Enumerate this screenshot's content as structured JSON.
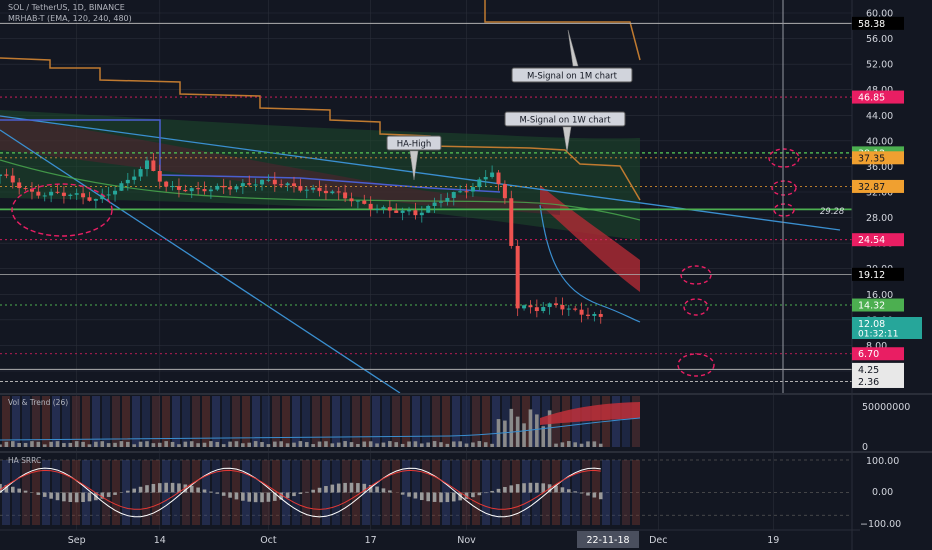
{
  "header": {
    "symbol": "SOL / TetherUS, 1D, BINANCE",
    "indicator": "MRHAB-T (EMA, 120, 240, 480)"
  },
  "colors": {
    "bg": "#131722",
    "grid": "#2a2e39",
    "up": "#26a69a",
    "down": "#ef5350",
    "green": "#4caf50",
    "orange": "#d08a30",
    "blue": "#3a8fd0",
    "pink": "#e91e63",
    "tag_green": "#4caf50",
    "tag_orange": "#f0a030",
    "tag_pink": "#e91e63",
    "tag_black": "#000000",
    "tag_white": "#e8e8e8"
  },
  "price_axis": {
    "ticks": [
      "60.00",
      "56.00",
      "52.00",
      "48.00",
      "44.00",
      "40.00",
      "36.00",
      "32.00",
      "28.00",
      "24.00",
      "20.00",
      "16.00",
      "12.00",
      "8.00",
      "4.00"
    ],
    "tags": [
      {
        "label": "58.38",
        "value": 58.38,
        "style": "black"
      },
      {
        "label": "46.85",
        "value": 46.85,
        "style": "pink"
      },
      {
        "label": "38.12",
        "value": 38.12,
        "style": "green"
      },
      {
        "label": "37.35",
        "value": 37.35,
        "style": "orange"
      },
      {
        "label": "32.87",
        "value": 32.87,
        "style": "orange"
      },
      {
        "label": "24.54",
        "value": 24.54,
        "style": "pink"
      },
      {
        "label": "19.12",
        "value": 19.12,
        "style": "black"
      },
      {
        "label": "14.32",
        "value": 14.32,
        "style": "green"
      },
      {
        "label": "6.70",
        "value": 6.7,
        "style": "pink"
      },
      {
        "label": "4.25",
        "value": 4.25,
        "style": "white"
      },
      {
        "label": "2.36",
        "value": 2.36,
        "style": "white"
      }
    ],
    "current_price": "12.08",
    "countdown": "01:32:11"
  },
  "annotations": {
    "m_signal_1m": "M-Signal on 1M chart",
    "m_signal_1w": "M-Signal on 1W chart",
    "ha_high": "HA-High",
    "level_2928": "29.28"
  },
  "volume_panel": {
    "title": "Vol & Trend (26)",
    "ticks": [
      "50000000",
      "0"
    ]
  },
  "osc_panel": {
    "title": "HA SRRC",
    "ticks": [
      "100.00",
      "0.00",
      "−100.00"
    ]
  },
  "time_axis": {
    "labels": [
      "Sep",
      "14",
      "Oct",
      "17",
      "Nov",
      "Dec",
      "19"
    ],
    "cursor_label": "22-11-18"
  },
  "chart_data": {
    "type": "candlestick",
    "title": "SOL / TetherUS, 1D, BINANCE",
    "ylim": [
      0,
      60
    ],
    "volume_ylim": [
      0,
      60000000
    ],
    "osc_ylim": [
      -100,
      100
    ],
    "x_start": "2022-08-20",
    "x_end": "2022-12-31",
    "time_ticks": [
      {
        "label": "Sep",
        "date": "2022-09-01"
      },
      {
        "label": "14",
        "date": "2022-09-14"
      },
      {
        "label": "Oct",
        "date": "2022-10-01"
      },
      {
        "label": "17",
        "date": "2022-10-17"
      },
      {
        "label": "Nov",
        "date": "2022-11-01"
      },
      {
        "label": "Dec",
        "date": "2022-12-01"
      },
      {
        "label": "19",
        "date": "2022-12-19"
      }
    ],
    "cursor_date": "2022-11-22",
    "close_series": [
      [
        "2022-08-20",
        34.5
      ],
      [
        "2022-08-25",
        32
      ],
      [
        "2022-08-30",
        31.5
      ],
      [
        "2022-09-04",
        31
      ],
      [
        "2022-09-09",
        33.5
      ],
      [
        "2022-09-12",
        36.5
      ],
      [
        "2022-09-15",
        33
      ],
      [
        "2022-09-20",
        32
      ],
      [
        "2022-09-25",
        33
      ],
      [
        "2022-09-30",
        33.5
      ],
      [
        "2022-10-05",
        33
      ],
      [
        "2022-10-10",
        32
      ],
      [
        "2022-10-15",
        30.5
      ],
      [
        "2022-10-20",
        29
      ],
      [
        "2022-10-24",
        28.5
      ],
      [
        "2022-10-28",
        31
      ],
      [
        "2022-11-02",
        32.5
      ],
      [
        "2022-11-05",
        35.5
      ],
      [
        "2022-11-07",
        31
      ],
      [
        "2022-11-08",
        24
      ],
      [
        "2022-11-09",
        14
      ],
      [
        "2022-11-12",
        13.5
      ],
      [
        "2022-11-15",
        14.5
      ],
      [
        "2022-11-18",
        13.5
      ],
      [
        "2022-11-22",
        12.08
      ]
    ],
    "horizontal_levels": [
      58.38,
      46.85,
      38.12,
      37.35,
      32.87,
      29.28,
      24.54,
      19.12,
      14.32,
      6.7,
      4.25,
      2.36
    ]
  }
}
